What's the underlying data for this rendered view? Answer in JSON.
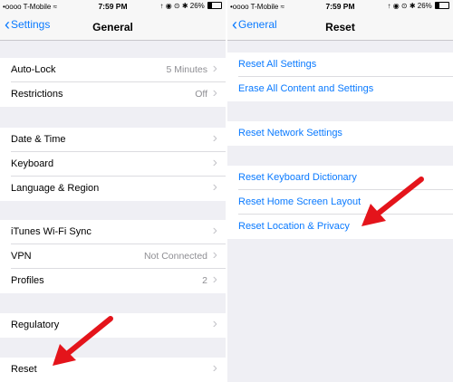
{
  "status_bar": {
    "carrier": "•oooo T-Mobile ≈",
    "time": "7:59 PM",
    "icons": "↑ ◉ ⊙ ✱ 26%",
    "battery_percent": 26
  },
  "left_screen": {
    "nav": {
      "back_label": "Settings",
      "title": "General"
    },
    "rows": [
      {
        "label": "Auto-Lock",
        "value": "5 Minutes"
      },
      {
        "label": "Restrictions",
        "value": "Off"
      },
      {
        "label": "Date & Time",
        "value": ""
      },
      {
        "label": "Keyboard",
        "value": ""
      },
      {
        "label": "Language & Region",
        "value": ""
      },
      {
        "label": "iTunes Wi-Fi Sync",
        "value": ""
      },
      {
        "label": "VPN",
        "value": "Not Connected"
      },
      {
        "label": "Profiles",
        "value": "2"
      },
      {
        "label": "Regulatory",
        "value": ""
      },
      {
        "label": "Reset",
        "value": ""
      }
    ]
  },
  "right_screen": {
    "nav": {
      "back_label": "General",
      "title": "Reset"
    },
    "rows": [
      {
        "label": "Reset All Settings"
      },
      {
        "label": "Erase All Content and Settings"
      },
      {
        "label": "Reset Network Settings"
      },
      {
        "label": "Reset Keyboard Dictionary"
      },
      {
        "label": "Reset Home Screen Layout"
      },
      {
        "label": "Reset Location & Privacy"
      }
    ]
  },
  "colors": {
    "accent": "#0a7aff",
    "arrow": "#e4141b",
    "background": "#efeff4"
  }
}
